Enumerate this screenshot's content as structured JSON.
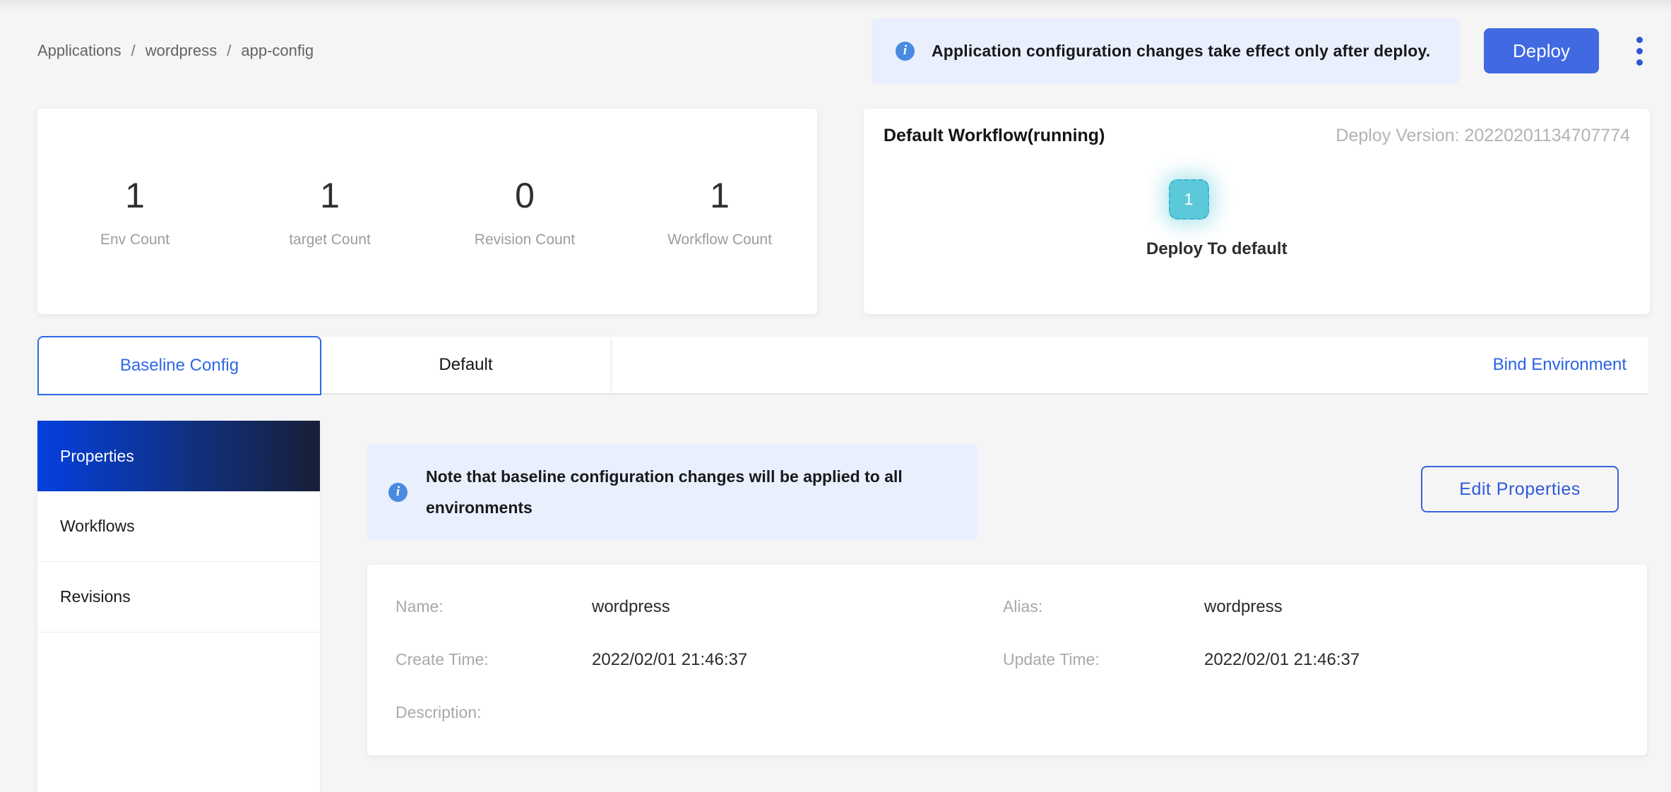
{
  "breadcrumb": {
    "items": [
      "Applications",
      "wordpress",
      "app-config"
    ],
    "separator": "/"
  },
  "header": {
    "alert_text": "Application configuration changes take effect only after deploy.",
    "deploy_label": "Deploy"
  },
  "stats": {
    "items": [
      {
        "value": "1",
        "label": "Env Count"
      },
      {
        "value": "1",
        "label": "target Count"
      },
      {
        "value": "0",
        "label": "Revision Count"
      },
      {
        "value": "1",
        "label": "Workflow Count"
      }
    ]
  },
  "workflow_card": {
    "title": "Default Workflow(running)",
    "deploy_version_label": "Deploy Version:",
    "deploy_version_value": "20220201134707774",
    "node_badge": "1",
    "node_caption": "Deploy To default"
  },
  "tabs": {
    "active_tab": "Baseline Config",
    "second_tab": "Default",
    "bind_environment": "Bind Environment"
  },
  "sidebar": {
    "items": [
      {
        "label": "Properties",
        "active": true
      },
      {
        "label": "Workflows",
        "active": false
      },
      {
        "label": "Revisions",
        "active": false
      }
    ]
  },
  "main": {
    "note_text": "Note that baseline configuration changes will be applied to all environments",
    "edit_button_label": "Edit Properties",
    "properties": {
      "fields": [
        {
          "label": "Name:",
          "value": "wordpress"
        },
        {
          "label": "Alias:",
          "value": "wordpress"
        },
        {
          "label": "Create Time:",
          "value": "2022/02/01 21:46:37"
        },
        {
          "label": "Update Time:",
          "value": "2022/02/01 21:46:37"
        },
        {
          "label": "Description:",
          "value": ""
        }
      ]
    }
  },
  "colors": {
    "primary_button_blue": "#4069e2",
    "link_blue": "#2b62e3",
    "active_tab_blue": "#2e68e8",
    "sidebar_gradient_start": "#0540e0",
    "sidebar_gradient_end": "#171f36",
    "banner_bg": "#e9effc",
    "info_icon_blue": "#4a8ae0",
    "workflow_node_cyan": "#5cc9db",
    "page_bg": "#f5f5f6"
  }
}
